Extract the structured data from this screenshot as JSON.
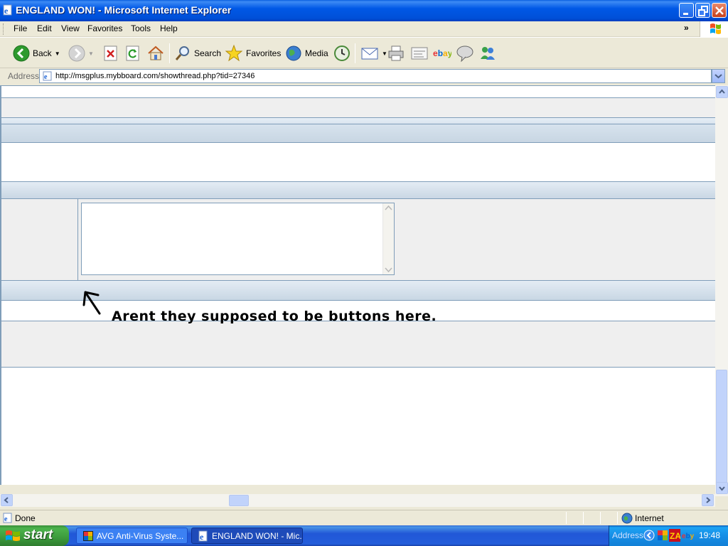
{
  "window": {
    "title": "ENGLAND WON! - Microsoft Internet Explorer"
  },
  "menu": {
    "items": [
      "File",
      "Edit",
      "View",
      "Favorites",
      "Tools",
      "Help"
    ],
    "chevron": "»"
  },
  "toolbar": {
    "back_label": "Back",
    "search_label": "Search",
    "favorites_label": "Favorites",
    "media_label": "Media"
  },
  "address": {
    "label": "Address",
    "url": "http://msgplus.mybboard.com/showthread.php?tid=27346"
  },
  "content": {
    "annotation": "Arent they supposed to be buttons here."
  },
  "status": {
    "text": "Done",
    "zone": "Internet"
  },
  "taskbar": {
    "start_label": "start",
    "tasks": [
      {
        "label": "AVG Anti-Virus Syste...",
        "active": false
      },
      {
        "label": "ENGLAND WON! - Mic...",
        "active": true
      }
    ],
    "tray_address": "Address",
    "clock": "19:48"
  },
  "colors": {
    "titlebar": "#0058e6",
    "border_blue": "#7f9db9",
    "panel_gray": "#efefef",
    "start_green": "#3c9a3c"
  }
}
